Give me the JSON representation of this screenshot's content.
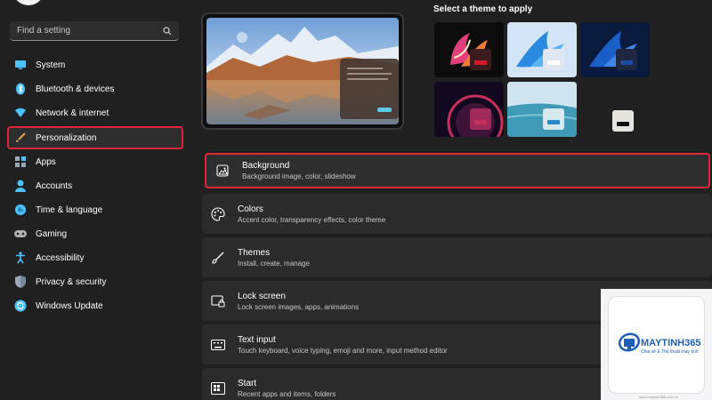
{
  "search": {
    "placeholder": "Find a setting"
  },
  "sidebar": {
    "items": [
      {
        "label": "System",
        "icon": "system-icon",
        "color": "#4cc2ff"
      },
      {
        "label": "Bluetooth & devices",
        "icon": "bluetooth-icon",
        "color": "#4cc2ff"
      },
      {
        "label": "Network & internet",
        "icon": "network-icon",
        "color": "#4cc2ff"
      },
      {
        "label": "Personalization",
        "icon": "brush-icon",
        "color": "#e8a14a",
        "active": true
      },
      {
        "label": "Apps",
        "icon": "apps-icon",
        "color": "#9aa7b8"
      },
      {
        "label": "Accounts",
        "icon": "accounts-icon",
        "color": "#4cc2ff"
      },
      {
        "label": "Time & language",
        "icon": "globe-icon",
        "color": "#4cc2ff"
      },
      {
        "label": "Gaming",
        "icon": "gamepad-icon",
        "color": "#b0b0b0"
      },
      {
        "label": "Accessibility",
        "icon": "accessibility-icon",
        "color": "#4cc2ff"
      },
      {
        "label": "Privacy & security",
        "icon": "shield-icon",
        "color": "#9aa7b8"
      },
      {
        "label": "Windows Update",
        "icon": "update-icon",
        "color": "#4cc2ff"
      }
    ]
  },
  "themes": {
    "title": "Select a theme to apply",
    "tiles": [
      {
        "name": "glow-theme",
        "accent": "#d41a28",
        "swatch": "#3b1b1e"
      },
      {
        "name": "windows-light-theme",
        "accent": "#ffffff",
        "swatch": "#dfe8f2"
      },
      {
        "name": "windows-dark-theme",
        "accent": "#1f4ca0",
        "swatch": "#1d2740"
      },
      {
        "name": "captured-motion-theme",
        "accent": "#c8305a",
        "swatch": "#a02a5a"
      },
      {
        "name": "flow-theme",
        "accent": "#2b89c7",
        "swatch": "#d8e8ef"
      },
      {
        "name": "high-contrast-theme",
        "accent": "#101010",
        "swatch": "#e6e4e0"
      }
    ]
  },
  "cards": [
    {
      "title": "Background",
      "subtitle": "Background image, color, slideshow",
      "icon": "image-icon",
      "highlighted": true
    },
    {
      "title": "Colors",
      "subtitle": "Accent color, transparency effects, color theme",
      "icon": "palette-icon"
    },
    {
      "title": "Themes",
      "subtitle": "Install, create, manage",
      "icon": "brush-icon"
    },
    {
      "title": "Lock screen",
      "subtitle": "Lock screen images, apps, animations",
      "icon": "lock-screen-icon"
    },
    {
      "title": "Text input",
      "subtitle": "Touch keyboard, voice typing, emoji and more, input method editor",
      "icon": "keyboard-icon"
    },
    {
      "title": "Start",
      "subtitle": "Recent apps and items, folders",
      "icon": "start-icon"
    }
  ],
  "watermark": {
    "brand": "MAYTINH365",
    "tagline": "Chia sẻ & Thủ thuật máy tính",
    "url": "www.maytinh365.com.vn"
  }
}
